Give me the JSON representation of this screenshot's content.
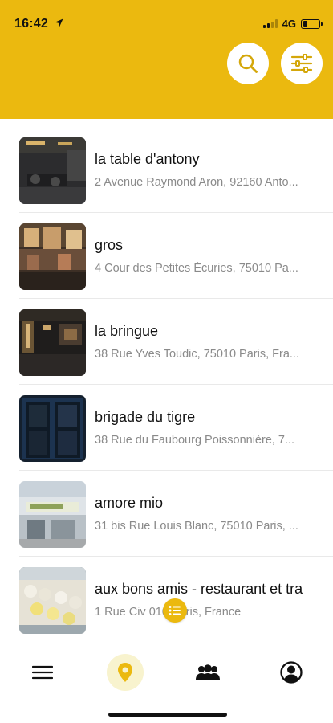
{
  "status_bar": {
    "time": "16:42",
    "network": "4G",
    "battery_level": 0.3
  },
  "header": {
    "background_color": "#ebb90f",
    "buttons": [
      {
        "icon": "search-icon"
      },
      {
        "icon": "filter-sliders-icon"
      }
    ]
  },
  "restaurants": [
    {
      "name": "la table d'antony",
      "address": "2 Avenue Raymond Aron, 92160 Anto..."
    },
    {
      "name": "gros",
      "address": "4 Cour des Petites Écuries, 75010 Pa..."
    },
    {
      "name": "la bringue",
      "address": "38 Rue Yves Toudic, 75010 Paris, Fra..."
    },
    {
      "name": "brigade du tigre",
      "address": "38 Rue du Faubourg Poissonnière, 7..."
    },
    {
      "name": "amore mio",
      "address": "31 bis Rue Louis Blanc, 75010 Paris, ..."
    },
    {
      "name": "aux bons amis - restaurant et tra",
      "address": "1 Rue Civ 010 Paris, France"
    }
  ],
  "floating_button": {
    "icon": "list-icon",
    "color": "#ebb90f"
  },
  "tab_bar": {
    "items": [
      {
        "icon": "hamburger-menu-icon"
      },
      {
        "icon": "map-pin-icon",
        "active": true
      },
      {
        "icon": "group-icon"
      },
      {
        "icon": "profile-icon"
      }
    ],
    "accent": "#ebb90f"
  }
}
